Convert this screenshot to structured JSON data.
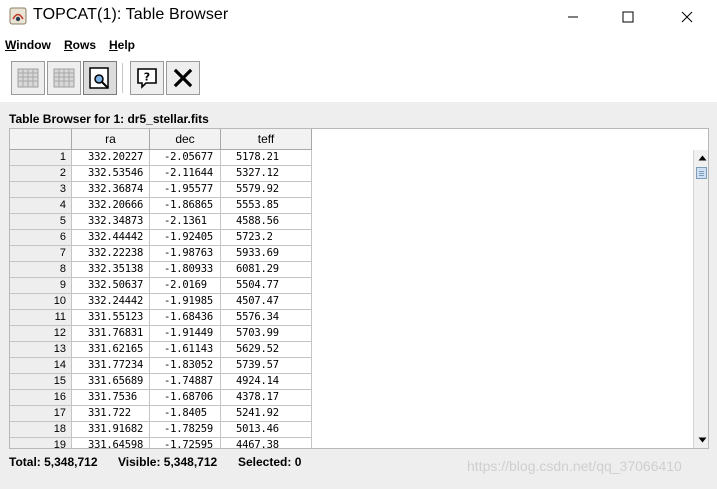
{
  "window": {
    "title": "TOPCAT(1): Table Browser",
    "app_icon": "topcat-app-icon",
    "controls": [
      "minimize-icon",
      "maximize-icon",
      "close-icon"
    ]
  },
  "menubar": {
    "items": [
      {
        "label_first": "W",
        "label_rest": "indow"
      },
      {
        "label_first": "R",
        "label_rest": "ows"
      },
      {
        "label_first": "H",
        "label_rest": "elp"
      }
    ]
  },
  "toolbar": {
    "buttons": [
      "table-grid-icon",
      "table-grid-alt-icon",
      "highlight-row-icon",
      "help-icon",
      "close-window-icon"
    ]
  },
  "browser": {
    "title": "Table Browser for 1: dr5_stellar.fits",
    "columns": [
      "ra",
      "dec",
      "teff"
    ],
    "rows": [
      [
        "1",
        "332.20227",
        "-2.05677",
        "5178.21"
      ],
      [
        "2",
        "332.53546",
        "-2.11644",
        "5327.12"
      ],
      [
        "3",
        "332.36874",
        "-1.95577",
        "5579.92"
      ],
      [
        "4",
        "332.20666",
        "-1.86865",
        "5553.85"
      ],
      [
        "5",
        "332.34873",
        "-2.1361",
        "4588.56"
      ],
      [
        "6",
        "332.44442",
        "-1.92405",
        "5723.2"
      ],
      [
        "7",
        "332.22238",
        "-1.98763",
        "5933.69"
      ],
      [
        "8",
        "332.35138",
        "-1.80933",
        "6081.29"
      ],
      [
        "9",
        "332.50637",
        "-2.0169",
        "5504.77"
      ],
      [
        "10",
        "332.24442",
        "-1.91985",
        "4507.47"
      ],
      [
        "11",
        "331.55123",
        "-1.68436",
        "5576.34"
      ],
      [
        "12",
        "331.76831",
        "-1.91449",
        "5703.99"
      ],
      [
        "13",
        "331.62165",
        "-1.61143",
        "5629.52"
      ],
      [
        "14",
        "331.77234",
        "-1.83052",
        "5739.57"
      ],
      [
        "15",
        "331.65689",
        "-1.74887",
        "4924.14"
      ],
      [
        "16",
        "331.7536",
        "-1.68706",
        "4378.17"
      ],
      [
        "17",
        "331.722",
        "-1.8405",
        "5241.92"
      ],
      [
        "18",
        "331.91682",
        "-1.78259",
        "5013.46"
      ],
      [
        "19",
        "331.64598",
        "-1.72595",
        "4467.38"
      ]
    ]
  },
  "status": {
    "total": "Total: 5,348,712",
    "visible": "Visible: 5,348,712",
    "selected": "Selected: 0"
  },
  "watermark": "https://blog.csdn.net/qq_37066410"
}
